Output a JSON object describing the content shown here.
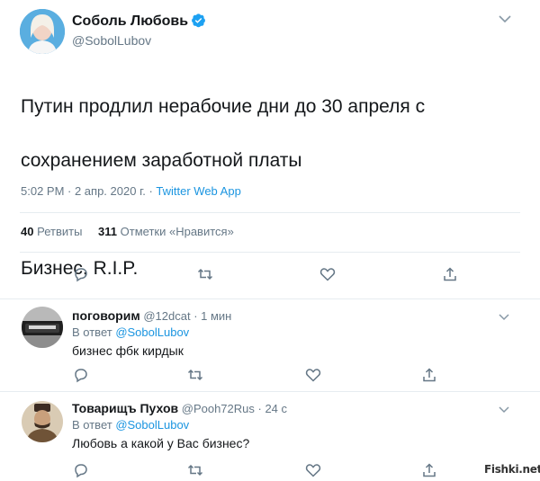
{
  "tweet": {
    "author_name": "Соболь Любовь",
    "author_handle": "@SobolLubov",
    "text_line1": "Путин продлил нерабочие дни до 30 апреля с",
    "text_line2": "сохранением заработной платы",
    "text_line3": "Бизнес, R.I.P.",
    "timestamp": "5:02 PM · 2 апр. 2020 г. · ",
    "client": "Twitter Web App",
    "retweets_count": "40",
    "retweets_label": "Ретвиты",
    "likes_count": "311",
    "likes_label": "Отметки «Нравится»",
    "icons": [
      "reply-icon",
      "retweet-icon",
      "like-icon",
      "share-icon"
    ]
  },
  "replies": [
    {
      "name": "поговорим",
      "handle": "@12dcat",
      "time": "· 1 мин",
      "in_reply_prefix": "В ответ ",
      "mention": "@SobolLubov",
      "text": "бизнес фбк кирдык"
    },
    {
      "name": "Товарищъ Пухов",
      "handle": "@Pooh72Rus",
      "time": "· 24 с",
      "in_reply_prefix": "В ответ ",
      "mention": "@SobolLubov",
      "text": "Любовь а какой у Вас бизнес?"
    }
  ],
  "watermark": "Fishki.net",
  "colors": {
    "link_blue": "#1b95e0",
    "secondary_text": "#657786",
    "divider": "#e6ecf0",
    "verified_blue": "#1da1f2"
  }
}
